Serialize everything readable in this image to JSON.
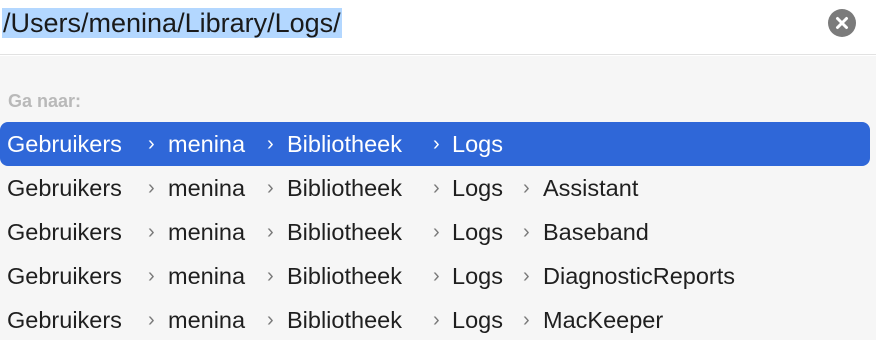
{
  "search": {
    "path_value": "/Users/menina/Library/Logs/",
    "clear_icon": "xmark-circle-fill-icon"
  },
  "section": {
    "title": "Ga naar:"
  },
  "separator": "›",
  "colors": {
    "highlight": "#2f67d8",
    "selection": "#b3d7ff",
    "header_text": "#b9b9b9"
  },
  "results": [
    {
      "segments": [
        "Gebruikers",
        "menina",
        "Bibliotheek",
        "Logs"
      ],
      "selected": true
    },
    {
      "segments": [
        "Gebruikers",
        "menina",
        "Bibliotheek",
        "Logs",
        "Assistant"
      ],
      "selected": false
    },
    {
      "segments": [
        "Gebruikers",
        "menina",
        "Bibliotheek",
        "Logs",
        "Baseband"
      ],
      "selected": false
    },
    {
      "segments": [
        "Gebruikers",
        "menina",
        "Bibliotheek",
        "Logs",
        "DiagnosticReports"
      ],
      "selected": false
    },
    {
      "segments": [
        "Gebruikers",
        "menina",
        "Bibliotheek",
        "Logs",
        "MacKeeper"
      ],
      "selected": false
    }
  ]
}
